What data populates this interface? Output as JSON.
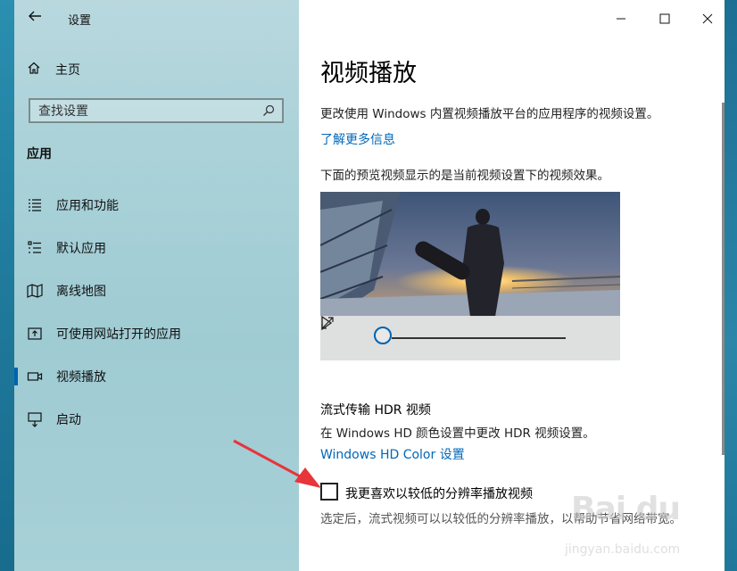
{
  "window": {
    "title": "设置"
  },
  "sidebar": {
    "home_label": "主页",
    "search_placeholder": "查找设置",
    "section_title": "应用",
    "items": [
      {
        "label": "应用和功能",
        "icon": "apps-features-icon"
      },
      {
        "label": "默认应用",
        "icon": "default-apps-icon"
      },
      {
        "label": "离线地图",
        "icon": "offline-maps-icon"
      },
      {
        "label": "可使用网站打开的应用",
        "icon": "apps-for-websites-icon"
      },
      {
        "label": "视频播放",
        "icon": "video-playback-icon",
        "active": true
      },
      {
        "label": "启动",
        "icon": "startup-icon"
      }
    ]
  },
  "content": {
    "title": "视频播放",
    "description": "更改使用 Windows 内置视频播放平台的应用程序的视频设置。",
    "learn_more": "了解更多信息",
    "preview_desc": "下面的预览视频显示的是当前视频设置下的视频效果。",
    "video": {
      "progress": 0.0
    },
    "hdr": {
      "title": "流式传输 HDR 视频",
      "desc": "在 Windows HD 颜色设置中更改 HDR 视频设置。",
      "link": "Windows HD Color 设置"
    },
    "low_res": {
      "label": "我更喜欢以较低的分辨率播放视频",
      "checked": false,
      "desc": "选定后，流式视频可以以较低的分辨率播放，以帮助节省网络带宽。"
    }
  },
  "watermark": {
    "brand": "Bai du",
    "url": "jingyan.baidu.com"
  },
  "colors": {
    "accent": "#0063b1",
    "link": "#0067b8",
    "annotation_arrow": "#e8343b"
  }
}
